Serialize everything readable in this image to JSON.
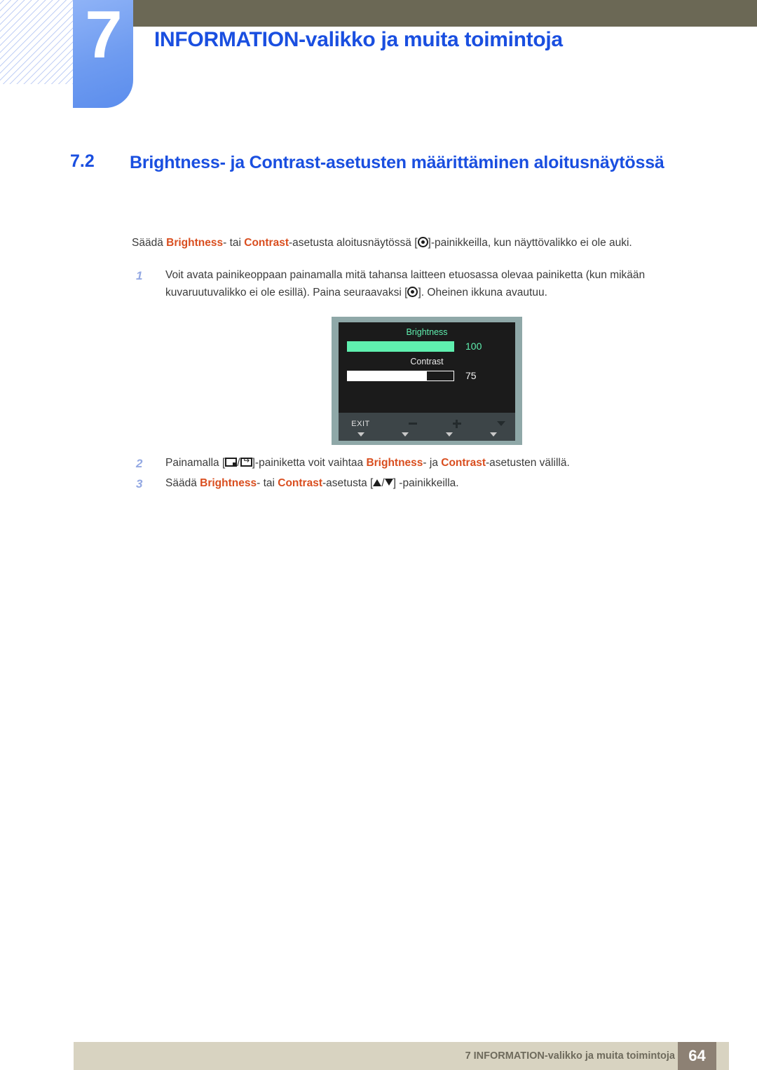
{
  "header": {
    "chapter_number": "7",
    "chapter_title": "INFORMATION-valikko ja muita toimintoja"
  },
  "section": {
    "number": "7.2",
    "title": "Brightness- ja Contrast-asetusten määrittäminen aloitusnäytössä"
  },
  "intro": {
    "p1": "Säädä ",
    "b1": "Brightness",
    "p2": "- tai ",
    "b2": "Contrast",
    "p3": "-asetusta aloitusnäytössä [",
    "p4": "]-painikkeilla, kun näyttövalikko ei ole auki."
  },
  "steps": [
    {
      "index": "1",
      "t1": "Voit avata painikeoppaan painamalla mitä tahansa laitteen etuosassa olevaa painiketta (kun mikään kuvaruutuvalikko ei ole esillä). Paina seuraavaksi [",
      "t2": "]. Oheinen ikkuna avautuu."
    },
    {
      "index": "2",
      "t1": "Painamalla [",
      "t2": "/",
      "t3": "]-painiketta voit vaihtaa ",
      "b1": "Brightness",
      "t4": "- ja ",
      "b2": "Contrast",
      "t5": "-asetusten välillä."
    },
    {
      "index": "3",
      "t1": "Säädä ",
      "b1": "Brightness",
      "t2": "- tai ",
      "b2": "Contrast",
      "t3": "-asetusta [",
      "t4": "/",
      "t5": "] -painikkeilla."
    }
  ],
  "osd": {
    "brightness_label": "Brightness",
    "brightness_value": "100",
    "contrast_label": "Contrast",
    "contrast_value": "75",
    "keys": [
      {
        "cap": "EXIT",
        "glyph": ""
      },
      {
        "cap": "",
        "glyph": "minus-icon"
      },
      {
        "cap": "",
        "glyph": "plus-icon"
      },
      {
        "cap": "",
        "glyph": "down-arrow-icon"
      }
    ]
  },
  "footer": {
    "text": "7 INFORMATION-valikko ja muita toimintoja",
    "page": "64"
  },
  "colors": {
    "heading_blue": "#1a4fe0",
    "emphasis_orange": "#d94e1f",
    "header_olive": "#6b6855",
    "badge_blue": "#6e9bf0",
    "osd_green": "#5fefaf",
    "footer_beige": "#d8d3c1",
    "footer_page_brown": "#8d8174"
  }
}
